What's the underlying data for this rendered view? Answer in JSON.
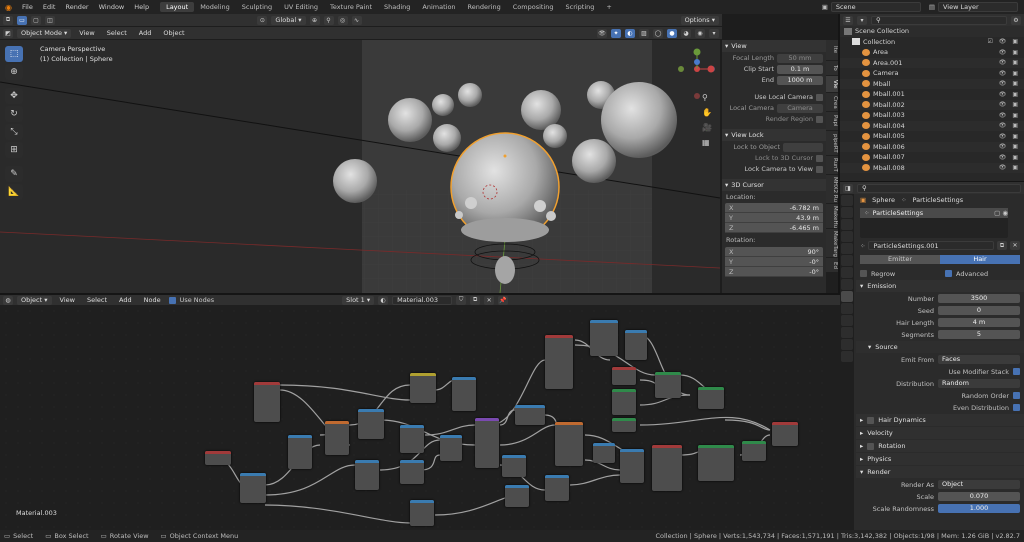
{
  "topbar": {
    "menus": [
      "File",
      "Edit",
      "Render",
      "Window",
      "Help"
    ],
    "workspaces": [
      "Layout",
      "Modeling",
      "Sculpting",
      "UV Editing",
      "Texture Paint",
      "Shading",
      "Animation",
      "Rendering",
      "Compositing",
      "Scripting"
    ],
    "active_workspace": "Layout",
    "add_tab": "+",
    "scene": "Scene",
    "view_layer": "View Layer"
  },
  "viewport": {
    "mode": "Object Mode",
    "menus": [
      "View",
      "Select",
      "Add",
      "Object"
    ],
    "orientation": "Global",
    "options": "Options",
    "camera_label": "Camera Perspective",
    "collection_label": "(1) Collection | Sphere"
  },
  "npanel": {
    "view_title": "View",
    "focal_length_label": "Focal Length",
    "focal_length": "50 mm",
    "clip_start_label": "Clip Start",
    "clip_start": "0.1 m",
    "end_label": "End",
    "end": "1000 m",
    "use_local_camera": "Use Local Camera",
    "local_camera_label": "Local Camera",
    "local_camera_value": "Camera",
    "render_region": "Render Region",
    "view_lock_title": "View Lock",
    "lock_to_object": "Lock to Object",
    "lock_to_3d_cursor": "Lock to 3D Cursor",
    "lock_camera_to_view": "Lock Camera to View",
    "cursor_title": "3D Cursor",
    "location_label": "Location:",
    "loc_x": "-6.782 m",
    "loc_y": "43.9 m",
    "loc_z": "-6.465 m",
    "rotation_label": "Rotation:",
    "rot_x": "90°",
    "rot_y": "-0°",
    "rot_z": "-0°",
    "tabs": [
      "Ite",
      "To",
      "Vie",
      "Crea",
      "Papi",
      "pipeRT",
      "RunT",
      "MHX2 Ru",
      "MakeHu",
      "MakeTarg",
      "Ed"
    ]
  },
  "outliner": {
    "root": "Scene Collection",
    "collection": "Collection",
    "items": [
      "Area",
      "Area.001",
      "Camera",
      "Mball",
      "Mball.001",
      "Mball.002",
      "Mball.003",
      "Mball.004",
      "Mball.005",
      "Mball.006",
      "Mball.007",
      "Mball.008"
    ]
  },
  "properties": {
    "object_name": "Sphere",
    "particle_settings_label": "ParticleSettings",
    "list_item": "ParticleSettings",
    "datablock": "ParticleSettings.001",
    "emitter": "Emitter",
    "hair": "Hair",
    "regrow": "Regrow",
    "advanced": "Advanced",
    "emission_title": "Emission",
    "number_label": "Number",
    "number": "3500",
    "seed_label": "Seed",
    "seed": "0",
    "hair_length_label": "Hair Length",
    "hair_length": "4 m",
    "segments_label": "Segments",
    "segments": "5",
    "source_title": "Source",
    "emit_from_label": "Emit From",
    "emit_from": "Faces",
    "use_modifier_stack": "Use Modifier Stack",
    "distribution_label": "Distribution",
    "distribution": "Random",
    "random_order": "Random Order",
    "even_distribution": "Even Distribution",
    "hair_dynamics": "Hair Dynamics",
    "velocity": "Velocity",
    "rotation": "Rotation",
    "physics": "Physics",
    "render_title": "Render",
    "render_as_label": "Render As",
    "render_as": "Object",
    "scale_label": "Scale",
    "scale": "0.070",
    "scale_randomness_label": "Scale Randomness",
    "scale_randomness": "1.000"
  },
  "node_editor": {
    "type": "Object",
    "menus": [
      "View",
      "Select",
      "Add",
      "Node"
    ],
    "use_nodes": "Use Nodes",
    "slot": "Slot 1",
    "material": "Material.003",
    "material_label": "Material.003"
  },
  "status": {
    "select": "Select",
    "box_select": "Box Select",
    "rotate_view": "Rotate View",
    "context_menu": "Object Context Menu",
    "stats": "Collection | Sphere | Verts:1,543,734 | Faces:1,571,191 | Tris:3,142,382 | Objects:1/98 | Mem: 1.26 GiB | v2.82.7"
  },
  "colors": {
    "accent": "#4772b3",
    "selection_outline": "#f0a030",
    "header_bg": "#303030"
  }
}
